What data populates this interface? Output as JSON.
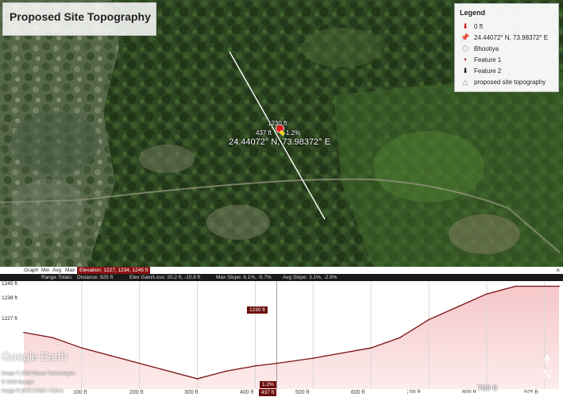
{
  "title": "Proposed Site Topography",
  "legend": {
    "title": "Legend",
    "items": [
      {
        "icon": "red-arrow-icon",
        "label": "0 ft"
      },
      {
        "icon": "yellow-pushpin-icon",
        "label": "24.44072° N, 73.98372° E"
      },
      {
        "icon": "polygon-outline-icon",
        "label": "Bhootiya"
      },
      {
        "icon": "red-dot-icon",
        "label": "Feature 1"
      },
      {
        "icon": "black-arrow-icon",
        "label": "Feature 2"
      },
      {
        "icon": "terrain-profile-icon",
        "label": "proposed site topography"
      }
    ]
  },
  "map": {
    "marker_elev": "1230 ft",
    "marker_dist": "437 ft",
    "marker_slope": "1.2%",
    "coord_label": "24.44072° N, 73.98372° E"
  },
  "profile": {
    "graph_label": "Graph",
    "min_label": "Min",
    "avg_label": "Avg",
    "max_label": "Max",
    "elevation_text": "Elevation: 1227, 1234, 1245 ft",
    "range_totals_label": "Range Totals:",
    "distance_text": "Distance: 925 ft",
    "gain_loss_text": "Elev Gain/Loss: 20.2 ft, -10.8 ft",
    "max_slope_text": "Max Slope: 6.1%, -5.7%",
    "avg_slope_text": "Avg Slope: 3.1%, -2.8%",
    "close_label": "×",
    "y_ticks": [
      "1245 ft",
      "1238 ft",
      "1227 ft"
    ],
    "x_ticks": [
      "100 ft",
      "200 ft",
      "300 ft",
      "400 ft",
      "500 ft",
      "600 ft",
      "700 ft",
      "800 ft",
      "925 ft"
    ],
    "cursor_elev": "1230 ft",
    "cursor_slope": "1.2%",
    "cursor_dist": "437 ft"
  },
  "chart_data": {
    "type": "area",
    "x": [
      0,
      50,
      100,
      150,
      200,
      250,
      300,
      350,
      400,
      437,
      500,
      550,
      600,
      650,
      700,
      750,
      800,
      850,
      925
    ],
    "values": [
      1236,
      1235,
      1233,
      1231.5,
      1230,
      1228.5,
      1227,
      1228.5,
      1229.5,
      1230,
      1231,
      1232,
      1233,
      1235,
      1238.5,
      1241,
      1243.5,
      1245,
      1245
    ],
    "xlabel": "",
    "ylabel": "",
    "xlim": [
      0,
      925
    ],
    "ylim": [
      1225,
      1246
    ],
    "fill_color": "#f5c6c8",
    "line_color": "#7a1010"
  },
  "attribution": {
    "brand": "Google Earth",
    "line1": "Image © 2020 Maxar Technologies",
    "line2": "© 2020 Google",
    "line3": "Image © 2020 CNES / Airbus"
  },
  "scale_label": "700 ft",
  "compass_label": "N"
}
